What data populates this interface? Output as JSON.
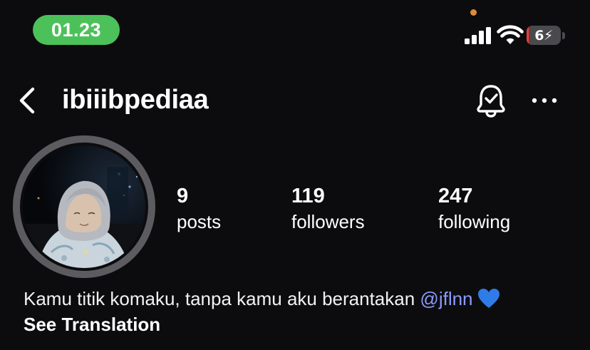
{
  "status_bar": {
    "time": "01.23",
    "time_pill_color": "#4cc15a",
    "privacy_dot_color": "#e08a3a",
    "battery_text": "6",
    "battery_level_percent": 6,
    "battery_low_color": "#ff3b30",
    "icons": [
      "signal-icon",
      "wifi-icon",
      "battery-icon",
      "charging-bolt-icon"
    ]
  },
  "header": {
    "username": "ibiiibpediaa",
    "icons": [
      "back-arrow-icon",
      "notification-bell-icon",
      "more-options-icon"
    ]
  },
  "profile": {
    "avatar_icon": "profile-photo",
    "stats": [
      {
        "value": "9",
        "label": "posts"
      },
      {
        "value": "119",
        "label": "followers"
      },
      {
        "value": "247",
        "label": "following"
      }
    ],
    "bio": {
      "text": "Kamu titik komaku, tanpa kamu aku berantakan",
      "mention": "@jflnn",
      "emoji_icon": "blue-heart-icon"
    },
    "see_translation": "See Translation"
  },
  "colors": {
    "background": "#0c0c0e",
    "mention": "#8c9bff",
    "heart": "#2f7be8"
  }
}
